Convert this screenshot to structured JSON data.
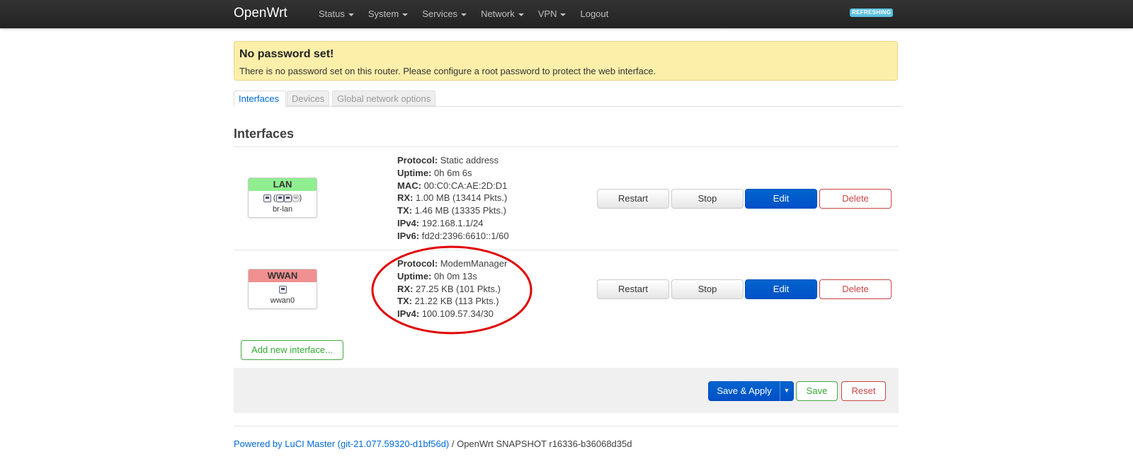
{
  "navbar": {
    "brand": "OpenWrt",
    "menu": [
      {
        "label": "Status",
        "dropdown": true
      },
      {
        "label": "System",
        "dropdown": true
      },
      {
        "label": "Services",
        "dropdown": true
      },
      {
        "label": "Network",
        "dropdown": true
      },
      {
        "label": "VPN",
        "dropdown": true
      },
      {
        "label": "Logout",
        "dropdown": false
      }
    ],
    "refresh_badge": "REFRESHING"
  },
  "alert": {
    "title": "No password set!",
    "text": "There is no password set on this router. Please configure a root password to protect the web interface."
  },
  "tabs": [
    {
      "label": "Interfaces",
      "active": true
    },
    {
      "label": "Devices",
      "active": false
    },
    {
      "label": "Global network options",
      "active": false
    }
  ],
  "section_title": "Interfaces",
  "interfaces": [
    {
      "name": "LAN",
      "color": "#90ee90",
      "icons": "(   )",
      "device": "br-lan",
      "details": [
        {
          "key": "Protocol:",
          "value": "Static address"
        },
        {
          "key": "Uptime:",
          "value": "0h 6m 6s"
        },
        {
          "key": "MAC:",
          "value": "00:C0:CA:AE:2D:D1"
        },
        {
          "key": "RX:",
          "value": "1.00 MB (13414 Pkts.)"
        },
        {
          "key": "TX:",
          "value": "1.46 MB (13335 Pkts.)"
        },
        {
          "key": "IPv4:",
          "value": "192.168.1.1/24"
        },
        {
          "key": "IPv6:",
          "value": "fd2d:2396:6610::1/60"
        }
      ]
    },
    {
      "name": "WWAN",
      "color": "#f09090",
      "device": "wwan0",
      "details": [
        {
          "key": "Protocol:",
          "value": "ModemManager"
        },
        {
          "key": "Uptime:",
          "value": "0h 0m 13s"
        },
        {
          "key": "RX:",
          "value": "27.25 KB (101 Pkts.)"
        },
        {
          "key": "TX:",
          "value": "21.22 KB (113 Pkts.)"
        },
        {
          "key": "IPv4:",
          "value": "100.109.57.34/30"
        }
      ]
    }
  ],
  "row_buttons": {
    "restart": "Restart",
    "stop": "Stop",
    "edit": "Edit",
    "delete": "Delete"
  },
  "add_interface": "Add new interface...",
  "actions": {
    "save_apply": "Save & Apply",
    "save_apply_caret": "▾",
    "save": "Save",
    "reset": "Reset"
  },
  "footer": {
    "luci_link": "Powered by LuCI Master (git-21.077.59320-d1bf56d)",
    "text": " / OpenWrt SNAPSHOT r16336-b36068d35d"
  },
  "colors": {
    "primary": "#0064cd",
    "danger": "#cc4444",
    "success": "#44aa44",
    "annotation": "#e00000"
  }
}
